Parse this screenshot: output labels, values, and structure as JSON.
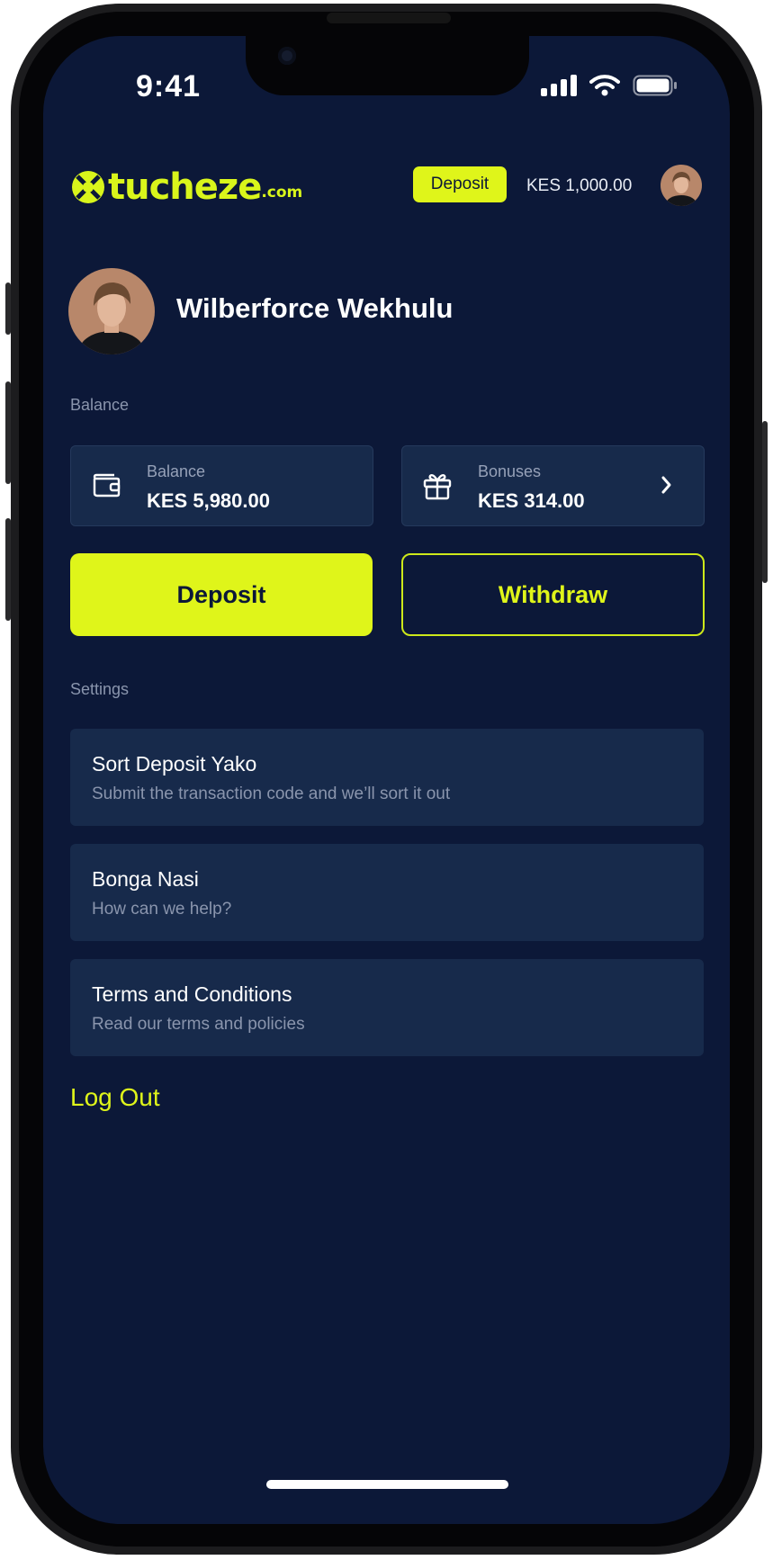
{
  "status_bar": {
    "time": "9:41"
  },
  "header": {
    "brand_name": "tucheze",
    "brand_suffix": ".com",
    "deposit_label": "Deposit",
    "balance": "KES 1,000.00"
  },
  "profile": {
    "name": "Wilberforce Wekhulu"
  },
  "balance_section": {
    "label": "Balance",
    "balance_card": {
      "label": "Balance",
      "value": "KES 5,980.00",
      "icon": "wallet-icon"
    },
    "bonuses_card": {
      "label": "Bonuses",
      "value": "KES 314.00",
      "icon": "gift-icon"
    }
  },
  "actions": {
    "deposit_label": "Deposit",
    "withdraw_label": "Withdraw"
  },
  "settings": {
    "label": "Settings",
    "items": [
      {
        "title": "Sort Deposit Yako",
        "subtitle": "Submit the transaction code and we’ll sort it out"
      },
      {
        "title": "Bonga Nasi",
        "subtitle": "How can we help?"
      },
      {
        "title": "Terms and Conditions",
        "subtitle": "Read our terms and policies"
      }
    ]
  },
  "logout_label": "Log Out",
  "colors": {
    "background": "#0c1838",
    "accent": "#dff51a",
    "card": "#172a4b"
  }
}
